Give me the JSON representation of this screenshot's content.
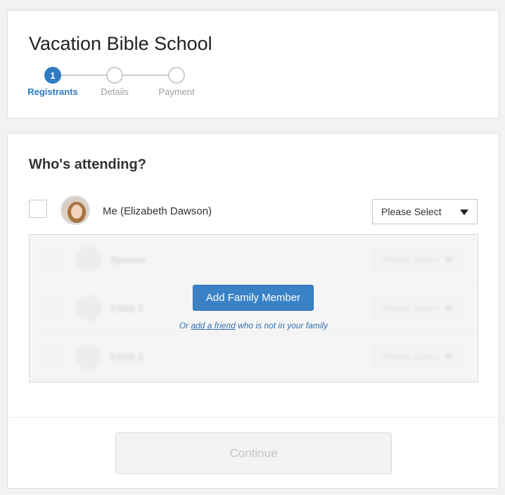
{
  "page": {
    "title": "Vacation Bible School"
  },
  "stepper": {
    "steps": [
      {
        "number": "1",
        "label": "Registrants",
        "active": true
      },
      {
        "number": "",
        "label": "Details",
        "active": false
      },
      {
        "number": "",
        "label": "Payment",
        "active": false
      }
    ]
  },
  "attending": {
    "heading": "Who's attending?",
    "me": {
      "name": "Me (Elizabeth Dawson)",
      "select_value": "Please Select",
      "checked": false
    },
    "family_placeholders": [
      {
        "name": "Spouse",
        "select_value": "Please Select"
      },
      {
        "name": "Child 1",
        "select_value": "Please Select"
      },
      {
        "name": "Child 2",
        "select_value": "Please Select"
      }
    ],
    "add_family_button": "Add Family Member",
    "friend_prefix": "Or",
    "friend_link": "add a friend",
    "friend_suffix": "who is not in your family"
  },
  "footer": {
    "continue_label": "Continue"
  },
  "colors": {
    "accent": "#2f7bc1",
    "button_primary": "#3a82c6",
    "disabled_text": "#c2c4c7"
  },
  "icons": {
    "select_caret": "caret-down-icon",
    "placeholder_avatar": "person-icon"
  }
}
